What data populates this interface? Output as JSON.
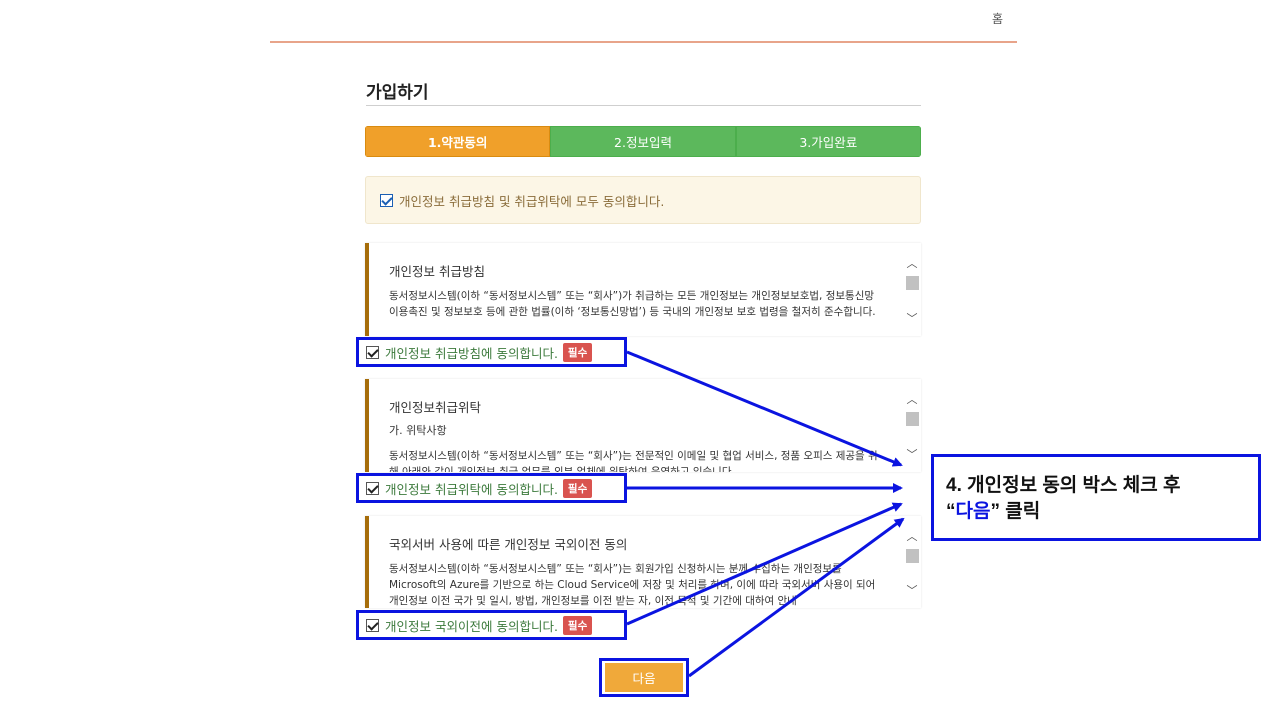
{
  "header": {
    "home_label": "홈"
  },
  "page": {
    "title": "가입하기"
  },
  "steps": [
    {
      "label": "1.약관동의",
      "active": true
    },
    {
      "label": "2.정보입력",
      "active": false
    },
    {
      "label": "3.가입완료",
      "active": false
    }
  ],
  "agree_all": {
    "label": "개인정보 취급방침 및 취급위탁에 모두 동의합니다.",
    "checked": true
  },
  "terms": [
    {
      "title": "개인정보 취급방침",
      "subtitle": "",
      "text": "동서정보시스템(이하 “동서정보시스템” 또는 “회사”)가 취급하는 모든 개인정보는 개인정보보호법, 정보통신망 이용촉진 및 정보보호 등에 관한 법률(이하 ‘정보통신망법’) 등 국내의 개인정보 보호 법령을 철저히 준수합니다.",
      "agree_label": "개인정보 취급방침에 동의합니다.",
      "badge": "필수",
      "checked": true
    },
    {
      "title": "개인정보취급위탁",
      "subtitle": "가. 위탁사항",
      "text": "동서정보시스템(이하 “동서정보시스템” 또는 “회사”)는 전문적인 이메일 및 협업 서비스, 정품 오피스 제공을 위해 아래와 같이 개인정보 취급 업무를 외부 업체에 위탁하여 운영하고 있습니다",
      "agree_label": "개인정보 취급위탁에 동의합니다.",
      "badge": "필수",
      "checked": true
    },
    {
      "title": "국외서버 사용에 따른 개인정보 국외이전 동의",
      "subtitle": "",
      "text": "동서정보시스템(이하 “동서정보시스템” 또는 “회사”)는 회원가입 신청하시는 분께 수집하는 개인정보를 Microsoft의 Azure를 기반으로 하는 Cloud Service에 저장 및 처리를 하며, 이에 따라 국외서버 사용이 되어 개인정보 이전 국가 및 일시, 방법, 개인정보를 이전 받는 자, 이전 목적 및 기간에 대하여 안내",
      "agree_label": "개인정보 국외이전에 동의합니다.",
      "badge": "필수",
      "checked": true
    }
  ],
  "next_button": {
    "label": "다음"
  },
  "callout": {
    "prefix": "4. 개인정보 동의 박스 체크 후",
    "quote_open": "“",
    "highlight": "다음",
    "quote_close": "”",
    "suffix": " 클릭"
  },
  "colors": {
    "accent_orange": "#f0a02a",
    "step_green": "#5cb85c",
    "annotation_blue": "#0b14e0",
    "badge_red": "#d9534f"
  }
}
